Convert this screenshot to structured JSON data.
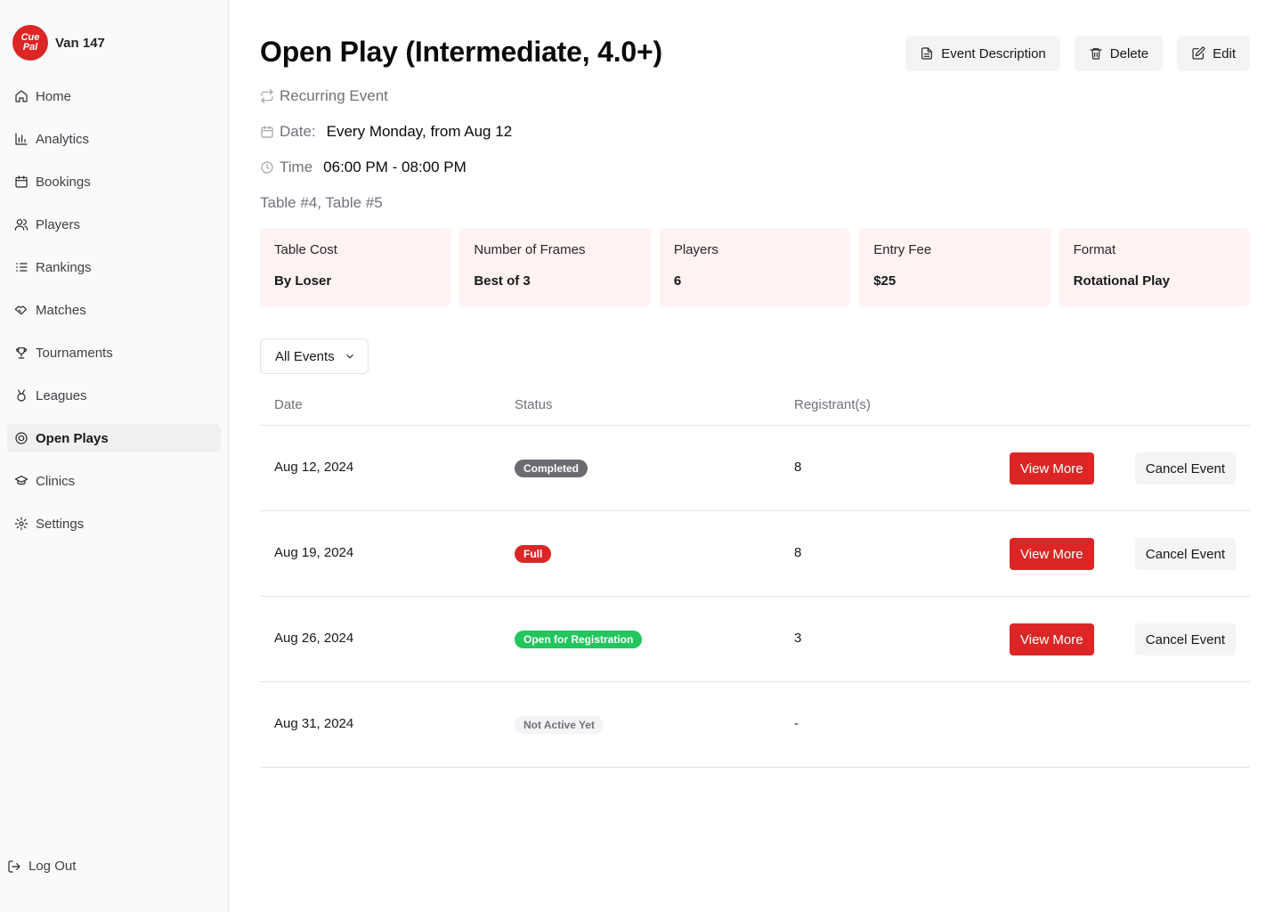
{
  "brand": {
    "logo_top": "Cue",
    "logo_bottom": "Pal",
    "name": "Van 147"
  },
  "sidebar": {
    "items": [
      {
        "label": "Home"
      },
      {
        "label": "Analytics"
      },
      {
        "label": "Bookings"
      },
      {
        "label": "Players"
      },
      {
        "label": "Rankings"
      },
      {
        "label": "Matches"
      },
      {
        "label": "Tournaments"
      },
      {
        "label": "Leagues"
      },
      {
        "label": "Open Plays"
      },
      {
        "label": "Clinics"
      },
      {
        "label": "Settings"
      }
    ],
    "active": "Open Plays",
    "logout": "Log Out"
  },
  "event": {
    "title": "Open Play (Intermediate, 4.0+)",
    "recurring": "Recurring Event",
    "date_label": "Date:",
    "date_value": "Every Monday, from Aug 12",
    "time_label": "Time",
    "time_value": "06:00 PM - 08:00 PM",
    "tables": "Table #4, Table #5"
  },
  "actions": {
    "description": "Event Description",
    "delete": "Delete",
    "edit": "Edit"
  },
  "cards": [
    {
      "label": "Table Cost",
      "value": "By Loser"
    },
    {
      "label": "Number of Frames",
      "value": "Best of 3"
    },
    {
      "label": "Players",
      "value": "6"
    },
    {
      "label": "Entry Fee",
      "value": "$25"
    },
    {
      "label": "Format",
      "value": "Rotational Play"
    }
  ],
  "filter": {
    "selected": "All Events"
  },
  "table": {
    "headers": {
      "date": "Date",
      "status": "Status",
      "registrants": "Registrant(s)"
    },
    "rows": [
      {
        "date": "Aug 12, 2024",
        "status": "Completed",
        "registrants": "8",
        "view": "View More",
        "cancel": "Cancel Event"
      },
      {
        "date": "Aug 19, 2024",
        "status": "Full",
        "registrants": "8",
        "view": "View More",
        "cancel": "Cancel Event"
      },
      {
        "date": "Aug 26, 2024",
        "status": "Open for Registration",
        "registrants": "3",
        "view": "View More",
        "cancel": "Cancel Event"
      },
      {
        "date": "Aug 31, 2024",
        "status": "Not Active Yet",
        "registrants": "-"
      }
    ]
  },
  "colors": {
    "accent": "#dc2626",
    "card_bg": "#fef2f2",
    "open_green": "#22c55e",
    "completed_gray": "#6b6b70"
  }
}
